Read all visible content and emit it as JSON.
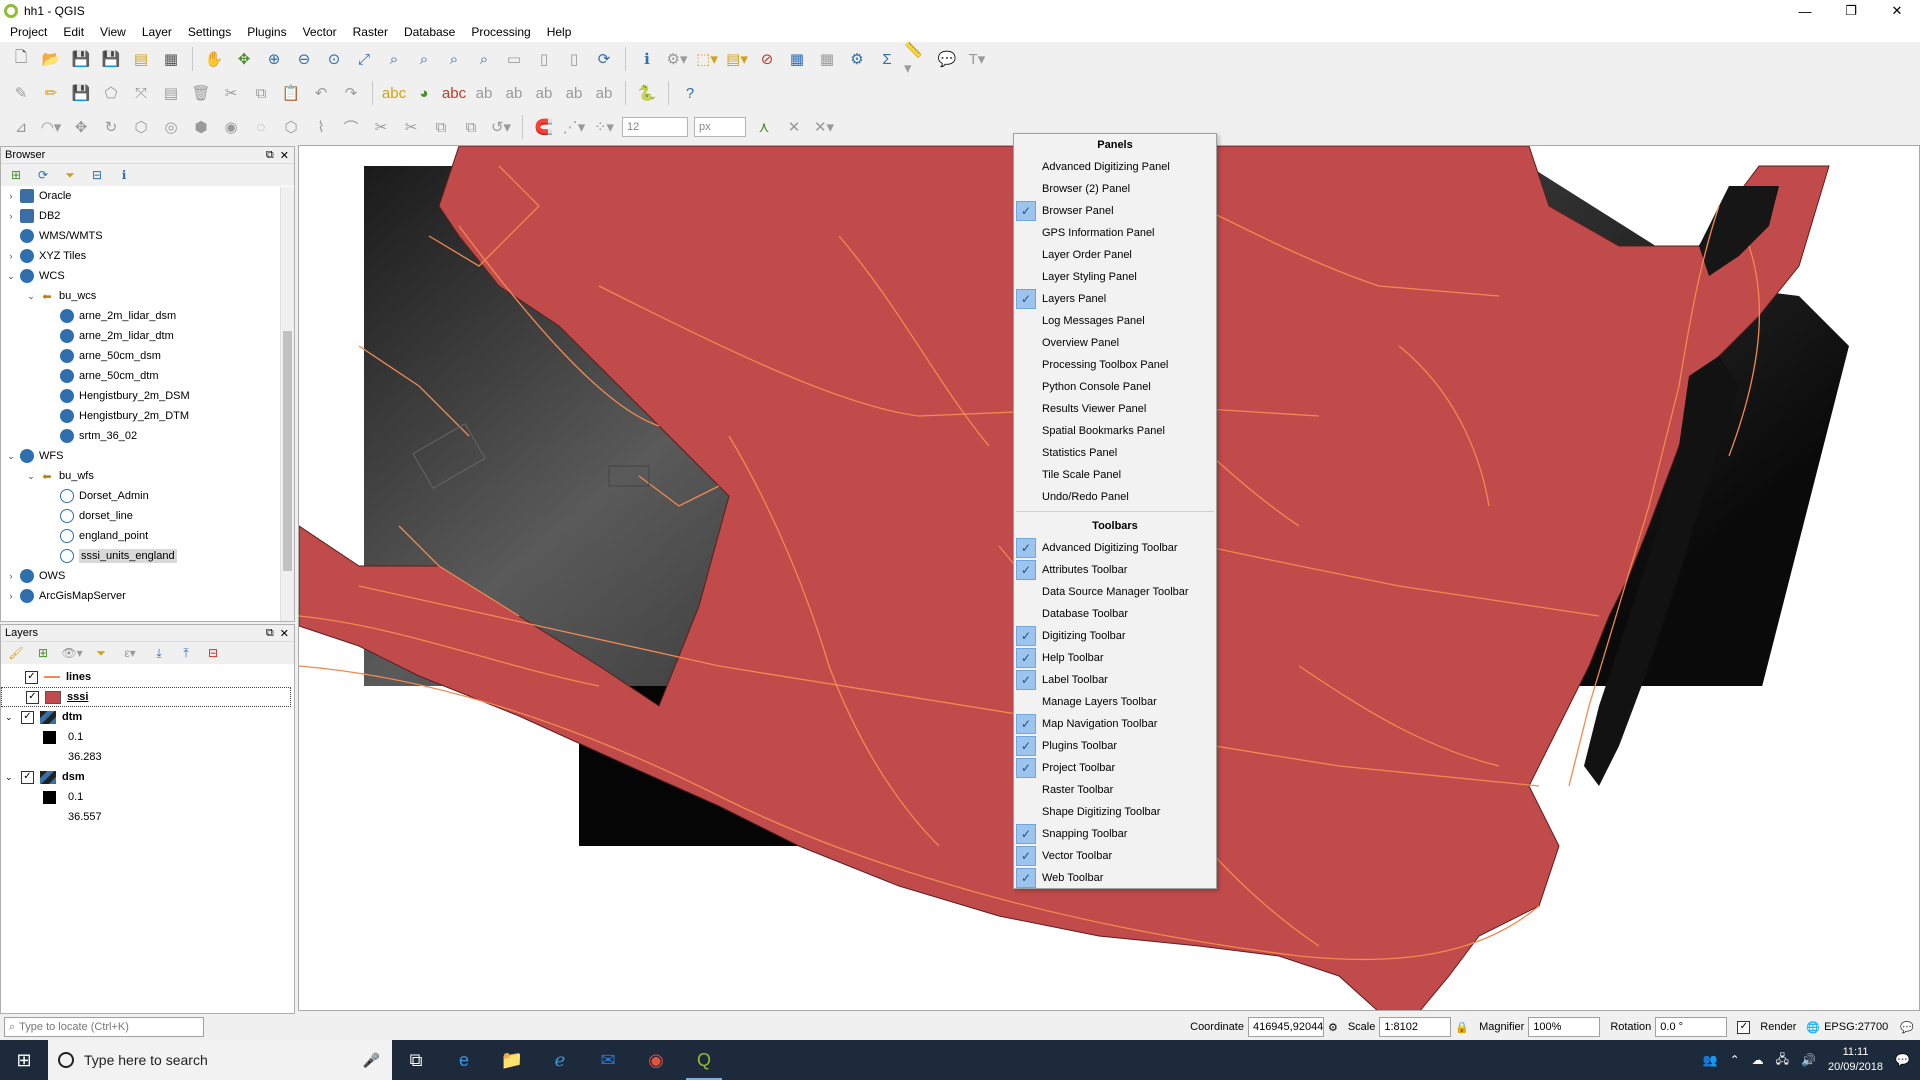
{
  "window": {
    "title": "hh1 - QGIS",
    "controls": [
      "—",
      "❐",
      "✕"
    ]
  },
  "menu": [
    "Project",
    "Edit",
    "View",
    "Layer",
    "Settings",
    "Plugins",
    "Vector",
    "Raster",
    "Database",
    "Processing",
    "Help"
  ],
  "toolbar3": {
    "snap_tolerance": "12",
    "snap_units": "px"
  },
  "browser": {
    "title": "Browser",
    "items": [
      {
        "label": "Oracle",
        "level": 0,
        "arrow": "›",
        "icon": "db"
      },
      {
        "label": "DB2",
        "level": 0,
        "arrow": "›",
        "icon": "db"
      },
      {
        "label": "WMS/WMTS",
        "level": 0,
        "arrow": "",
        "icon": "globe"
      },
      {
        "label": "XYZ Tiles",
        "level": 0,
        "arrow": "›",
        "icon": "globe"
      },
      {
        "label": "WCS",
        "level": 0,
        "arrow": "⌄",
        "icon": "globe"
      },
      {
        "label": "bu_wcs",
        "level": 1,
        "arrow": "⌄",
        "icon": "conn"
      },
      {
        "label": "arne_2m_lidar_dsm",
        "level": 2,
        "arrow": "",
        "icon": "globe"
      },
      {
        "label": "arne_2m_lidar_dtm",
        "level": 2,
        "arrow": "",
        "icon": "globe"
      },
      {
        "label": "arne_50cm_dsm",
        "level": 2,
        "arrow": "",
        "icon": "globe"
      },
      {
        "label": "arne_50cm_dtm",
        "level": 2,
        "arrow": "",
        "icon": "globe"
      },
      {
        "label": "Hengistbury_2m_DSM",
        "level": 2,
        "arrow": "",
        "icon": "globe"
      },
      {
        "label": "Hengistbury_2m_DTM",
        "level": 2,
        "arrow": "",
        "icon": "globe"
      },
      {
        "label": "srtm_36_02",
        "level": 2,
        "arrow": "",
        "icon": "globe"
      },
      {
        "label": "WFS",
        "level": 0,
        "arrow": "⌄",
        "icon": "globe"
      },
      {
        "label": "bu_wfs",
        "level": 1,
        "arrow": "⌄",
        "icon": "conn"
      },
      {
        "label": "Dorset_Admin",
        "level": 2,
        "arrow": "",
        "icon": "wfs"
      },
      {
        "label": "dorset_line",
        "level": 2,
        "arrow": "",
        "icon": "wfs"
      },
      {
        "label": "england_point",
        "level": 2,
        "arrow": "",
        "icon": "wfs"
      },
      {
        "label": "sssi_units_england",
        "level": 2,
        "arrow": "",
        "icon": "wfs",
        "selected": true
      },
      {
        "label": "OWS",
        "level": 0,
        "arrow": "›",
        "icon": "globe"
      },
      {
        "label": "ArcGisMapServer",
        "level": 0,
        "arrow": "›",
        "icon": "globe"
      }
    ]
  },
  "layers": {
    "title": "Layers",
    "items": [
      {
        "name": "lines",
        "type": "line",
        "color": "#f08a50",
        "checked": true
      },
      {
        "name": "sssi",
        "type": "fill",
        "color": "#c14b4b",
        "checked": true,
        "active": true
      },
      {
        "name": "dtm",
        "type": "raster",
        "checked": true,
        "min": "0.1",
        "max": "36.283"
      },
      {
        "name": "dsm",
        "type": "raster",
        "checked": true,
        "min": "0.1",
        "max": "36.557"
      }
    ]
  },
  "context_menu": {
    "panels_title": "Panels",
    "panels": [
      {
        "label": "Advanced Digitizing Panel",
        "checked": false
      },
      {
        "label": "Browser (2) Panel",
        "checked": false
      },
      {
        "label": "Browser Panel",
        "checked": true
      },
      {
        "label": "GPS Information Panel",
        "checked": false
      },
      {
        "label": "Layer Order Panel",
        "checked": false
      },
      {
        "label": "Layer Styling Panel",
        "checked": false
      },
      {
        "label": "Layers Panel",
        "checked": true
      },
      {
        "label": "Log Messages Panel",
        "checked": false
      },
      {
        "label": "Overview Panel",
        "checked": false
      },
      {
        "label": "Processing Toolbox Panel",
        "checked": false
      },
      {
        "label": "Python Console Panel",
        "checked": false
      },
      {
        "label": "Results Viewer Panel",
        "checked": false
      },
      {
        "label": "Spatial Bookmarks Panel",
        "checked": false
      },
      {
        "label": "Statistics Panel",
        "checked": false
      },
      {
        "label": "Tile Scale Panel",
        "checked": false
      },
      {
        "label": "Undo/Redo Panel",
        "checked": false
      }
    ],
    "toolbars_title": "Toolbars",
    "toolbars": [
      {
        "label": "Advanced Digitizing Toolbar",
        "checked": true
      },
      {
        "label": "Attributes Toolbar",
        "checked": true
      },
      {
        "label": "Data Source Manager Toolbar",
        "checked": false
      },
      {
        "label": "Database Toolbar",
        "checked": false
      },
      {
        "label": "Digitizing Toolbar",
        "checked": true
      },
      {
        "label": "Help Toolbar",
        "checked": true
      },
      {
        "label": "Label Toolbar",
        "checked": true
      },
      {
        "label": "Manage Layers Toolbar",
        "checked": false
      },
      {
        "label": "Map Navigation Toolbar",
        "checked": true
      },
      {
        "label": "Plugins Toolbar",
        "checked": true
      },
      {
        "label": "Project Toolbar",
        "checked": true
      },
      {
        "label": "Raster Toolbar",
        "checked": false
      },
      {
        "label": "Shape Digitizing Toolbar",
        "checked": false
      },
      {
        "label": "Snapping Toolbar",
        "checked": true
      },
      {
        "label": "Vector Toolbar",
        "checked": true
      },
      {
        "label": "Web Toolbar",
        "checked": true
      }
    ]
  },
  "statusbar": {
    "locate_placeholder": "Type to locate (Ctrl+K)",
    "coordinate_label": "Coordinate",
    "coordinate_value": "416945,92044",
    "scale_label": "Scale",
    "scale_value": "1:8102",
    "magnifier_label": "Magnifier",
    "magnifier_value": "100%",
    "rotation_label": "Rotation",
    "rotation_value": "0.0 °",
    "render_label": "Render",
    "crs": "EPSG:27700"
  },
  "taskbar": {
    "search_placeholder": "Type here to search",
    "time": "11:11",
    "date": "20/09/2018"
  }
}
